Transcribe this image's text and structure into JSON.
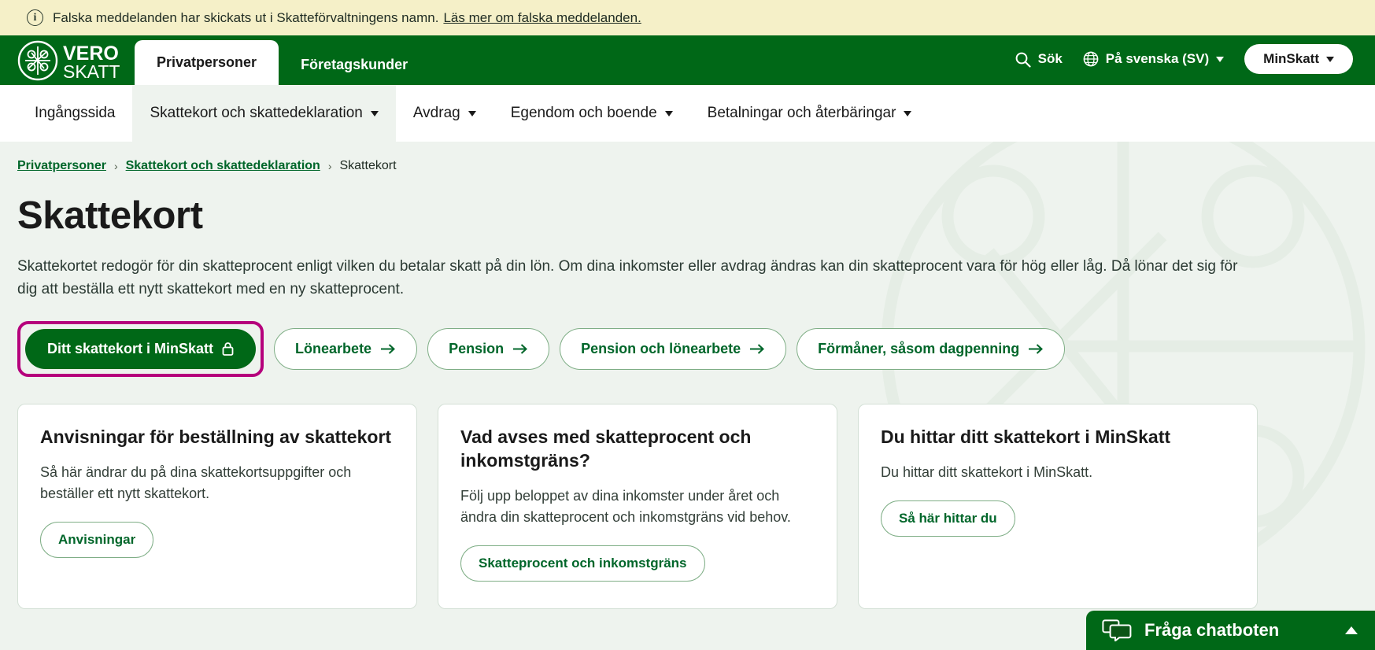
{
  "alert": {
    "icon": "info-circle-icon",
    "text": "Falska meddelanden har skickats ut i Skatteförvaltningens namn.",
    "link_label": "Läs mer om falska meddelanden."
  },
  "header": {
    "logo_alt": "VERO SKATT",
    "logo_line1": "VERO",
    "logo_line2": "SKATT",
    "tabs": [
      {
        "label": "Privatpersoner",
        "active": true
      },
      {
        "label": "Företagskunder",
        "active": false
      }
    ],
    "search_label": "Sök",
    "search_icon": "search-icon",
    "language_label": "På svenska (SV)",
    "language_icon": "globe-icon",
    "minskatt_label": "MinSkatt"
  },
  "subnav": {
    "items": [
      {
        "label": "Ingångssida",
        "has_caret": false,
        "active": false
      },
      {
        "label": "Skattekort och skattedeklaration",
        "has_caret": true,
        "active": true
      },
      {
        "label": "Avdrag",
        "has_caret": true,
        "active": false
      },
      {
        "label": "Egendom och boende",
        "has_caret": true,
        "active": false
      },
      {
        "label": "Betalningar och återbäringar",
        "has_caret": true,
        "active": false
      }
    ]
  },
  "breadcrumb": {
    "items": [
      {
        "label": "Privatpersoner",
        "link": true
      },
      {
        "label": "Skattekort och skattedeklaration",
        "link": true
      },
      {
        "label": "Skattekort",
        "link": false
      }
    ],
    "separator": "›"
  },
  "main": {
    "title": "Skattekort",
    "intro": "Skattekortet redogör för din skatteprocent enligt vilken du betalar skatt på din lön. Om dina inkomster eller avdrag ändras kan din skatteprocent vara för hög eller låg. Då lönar det sig för dig att beställa ett nytt skattekort med en ny skatteprocent.",
    "buttons": [
      {
        "label": "Ditt skattekort i MinSkatt",
        "icon": "lock-icon",
        "style": "primary",
        "focused": true
      },
      {
        "label": "Lönearbete",
        "icon": "arrow-right-icon",
        "style": "pill",
        "focused": false
      },
      {
        "label": "Pension",
        "icon": "arrow-right-icon",
        "style": "pill",
        "focused": false
      },
      {
        "label": "Pension och lönearbete",
        "icon": "arrow-right-icon",
        "style": "pill",
        "focused": false
      },
      {
        "label": "Förmåner, såsom dagpenning",
        "icon": "arrow-right-icon",
        "style": "pill",
        "focused": false
      }
    ],
    "cards": [
      {
        "title": "Anvisningar för beställning av skattekort",
        "body": "Så här ändrar du på dina skattekortsuppgifter och beställer ett nytt skattekort.",
        "button_label": "Anvisningar"
      },
      {
        "title": "Vad avses med skatteprocent och inkomstgräns?",
        "body": "Följ upp beloppet av dina inkomster under året och ändra din skatteprocent och inkomstgräns vid behov.",
        "button_label": "Skatteprocent och inkomstgräns"
      },
      {
        "title": "Du hittar ditt skattekort i MinSkatt",
        "body": "Du hittar ditt skattekort i MinSkatt.",
        "button_label": "Så här hittar du"
      }
    ]
  },
  "chatbot": {
    "label": "Fråga chatboten",
    "icon": "chat-bubbles-icon",
    "toggle_icon": "chevron-up-icon"
  },
  "colors": {
    "brand_green": "#006817",
    "link_green": "#00662a",
    "alert_bg": "#f5f0c8",
    "page_bg": "#eef3ee",
    "focus_ring": "#b5007c"
  }
}
